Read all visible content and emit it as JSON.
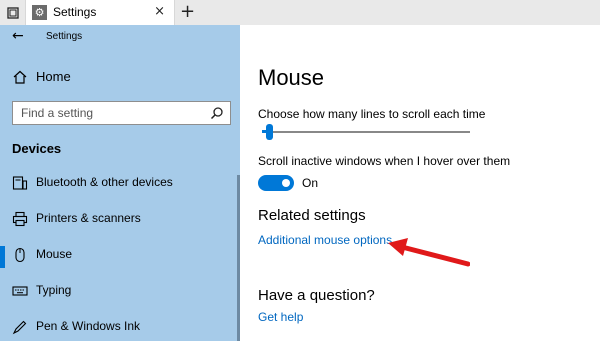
{
  "tab": {
    "title": "Settings",
    "close_label": "×",
    "add_label": "+"
  },
  "header": {
    "back_label": "←",
    "app_title": "Settings"
  },
  "sidebar": {
    "home_label": "Home",
    "search_placeholder": "Find a setting",
    "section_label": "Devices",
    "items": [
      {
        "label": "Bluetooth & other devices",
        "icon": "bluetooth-devices-icon"
      },
      {
        "label": "Printers & scanners",
        "icon": "printer-icon"
      },
      {
        "label": "Mouse",
        "icon": "mouse-icon",
        "selected": true
      },
      {
        "label": "Typing",
        "icon": "keyboard-icon"
      },
      {
        "label": "Pen & Windows Ink",
        "icon": "pen-icon"
      }
    ]
  },
  "main": {
    "title": "Mouse",
    "scroll_lines_label": "Choose how many lines to scroll each time",
    "scroll_lines_level": 0.02,
    "inactive_scroll_label": "Scroll inactive windows when I hover over them",
    "inactive_scroll_state": "On",
    "related_heading": "Related settings",
    "related_link": "Additional mouse options",
    "question_heading": "Have a question?",
    "help_link": "Get help"
  },
  "colors": {
    "accent": "#0078d7",
    "sidebar_bg": "#a6cbe9",
    "link": "#0067c0",
    "annotation_arrow": "#e0191a"
  }
}
